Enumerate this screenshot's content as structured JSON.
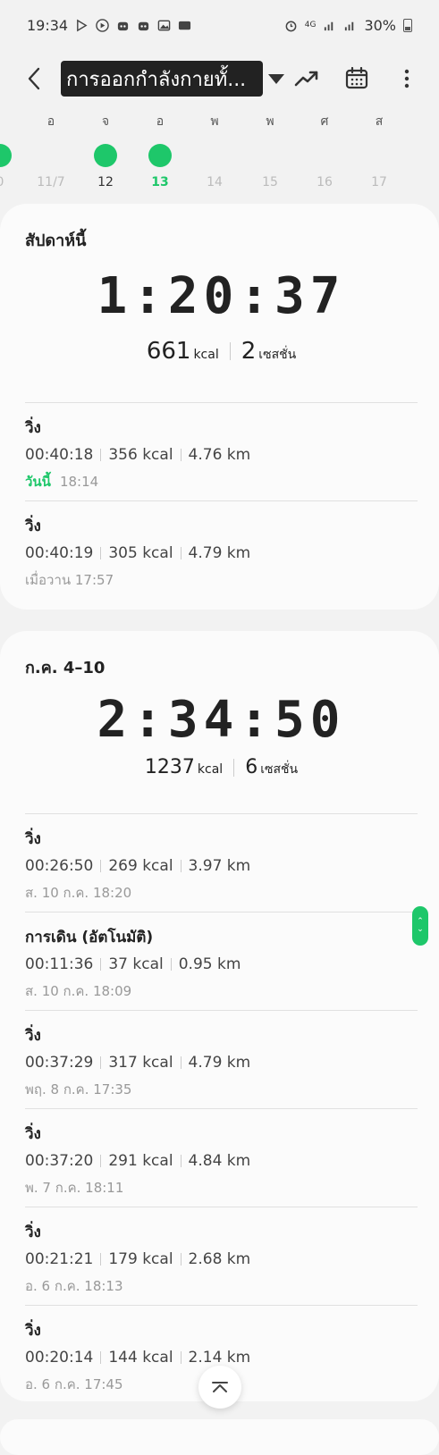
{
  "status_bar": {
    "time": "19:34",
    "battery": "30%",
    "network": "4G"
  },
  "app_bar": {
    "title": "การออกกำลังกายทั้...",
    "icons": [
      "back-arrow-icon",
      "dropdown-caret-icon",
      "trend-icon",
      "calendar-icon",
      "more-vert-icon"
    ]
  },
  "week": {
    "days": [
      {
        "letter": "",
        "num": "0",
        "dot": true,
        "state": "past"
      },
      {
        "letter": "อ",
        "num": "11/7",
        "dot": false,
        "state": "past"
      },
      {
        "letter": "จ",
        "num": "12",
        "dot": true,
        "state": "dark"
      },
      {
        "letter": "อ",
        "num": "13",
        "dot": true,
        "state": "today"
      },
      {
        "letter": "พ",
        "num": "14",
        "dot": false,
        "state": "future"
      },
      {
        "letter": "พ",
        "num": "15",
        "dot": false,
        "state": "future"
      },
      {
        "letter": "ศ",
        "num": "16",
        "dot": false,
        "state": "future"
      },
      {
        "letter": "ส",
        "num": "17",
        "dot": false,
        "state": "future"
      }
    ]
  },
  "this_week": {
    "title": "สัปดาห์นี้",
    "total_time": "1:20:37",
    "kcal": "661",
    "kcal_unit": "kcal",
    "sessions": "2",
    "sessions_unit": "เซสชั่น",
    "entries": [
      {
        "name": "วิ่ง",
        "duration": "00:40:18",
        "kcal": "356 kcal",
        "distance": "4.76 km",
        "date_label": "วันนี้",
        "date": "18:14"
      },
      {
        "name": "วิ่ง",
        "duration": "00:40:19",
        "kcal": "305 kcal",
        "distance": "4.79 km",
        "date_label": "",
        "date": "เมื่อวาน 17:57"
      }
    ]
  },
  "prev_week": {
    "title": "ก.ค. 4–10",
    "total_time": "2:34:50",
    "kcal": "1237",
    "kcal_unit": "kcal",
    "sessions": "6",
    "sessions_unit": "เซสชั่น",
    "entries": [
      {
        "name": "วิ่ง",
        "duration": "00:26:50",
        "kcal": "269 kcal",
        "distance": "3.97 km",
        "date": "ส. 10 ก.ค. 18:20"
      },
      {
        "name": "การเดิน (อัตโนมัติ)",
        "duration": "00:11:36",
        "kcal": "37 kcal",
        "distance": "0.95 km",
        "date": "ส. 10 ก.ค. 18:09"
      },
      {
        "name": "วิ่ง",
        "duration": "00:37:29",
        "kcal": "317 kcal",
        "distance": "4.79 km",
        "date": "พฤ. 8 ก.ค. 17:35"
      },
      {
        "name": "วิ่ง",
        "duration": "00:37:20",
        "kcal": "291 kcal",
        "distance": "4.84 km",
        "date": "พ. 7 ก.ค. 18:11"
      },
      {
        "name": "วิ่ง",
        "duration": "00:21:21",
        "kcal": "179 kcal",
        "distance": "2.68 km",
        "date": "อ. 6 ก.ค. 18:13"
      },
      {
        "name": "วิ่ง",
        "duration": "00:20:14",
        "kcal": "144 kcal",
        "distance": "2.14 km",
        "date": "อ. 6 ก.ค. 17:45"
      }
    ]
  },
  "colors": {
    "accent": "#1ec76a",
    "background": "#f2f2f2",
    "card": "#fbfbfb"
  }
}
